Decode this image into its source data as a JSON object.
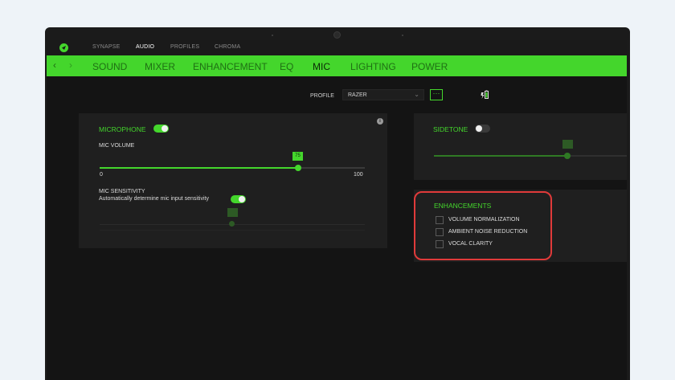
{
  "app": {
    "top_tabs": [
      {
        "label": "SYNAPSE"
      },
      {
        "label": "AUDIO"
      },
      {
        "label": "PROFILES"
      },
      {
        "label": "CHROMA"
      }
    ],
    "nav_tabs": [
      {
        "label": "SOUND"
      },
      {
        "label": "MIXER"
      },
      {
        "label": "ENHANCEMENT"
      },
      {
        "label": "EQ"
      },
      {
        "label": "MIC"
      },
      {
        "label": "LIGHTING"
      },
      {
        "label": "POWER"
      }
    ],
    "active_top_tab": "AUDIO",
    "active_nav_tab": "MIC"
  },
  "profile": {
    "label": "PROFILE",
    "value": "RAZER",
    "more_icon": "ellipsis-icon",
    "battery_icon": "battery-charging-icon"
  },
  "microphone": {
    "title": "MICROPHONE",
    "enabled": true,
    "volume_label": "MIC VOLUME",
    "volume_value": "75",
    "volume_min": "0",
    "volume_max": "100",
    "sensitivity_title": "MIC SENSITIVITY",
    "sensitivity_auto_label": "Automatically determine mic input sensitivity",
    "sensitivity_auto": true
  },
  "sidetone": {
    "title": "SIDETONE",
    "enabled": false
  },
  "enhancements": {
    "title": "ENHANCEMENTS",
    "items": [
      {
        "label": "VOLUME NORMALIZATION",
        "checked": false
      },
      {
        "label": "AMBIENT NOISE REDUCTION",
        "checked": false
      },
      {
        "label": "VOCAL CLARITY",
        "checked": false
      }
    ]
  },
  "colors": {
    "accent": "#44d62c",
    "highlight": "#e03a3a",
    "panel": "#1f1f1f",
    "background": "#141414"
  }
}
